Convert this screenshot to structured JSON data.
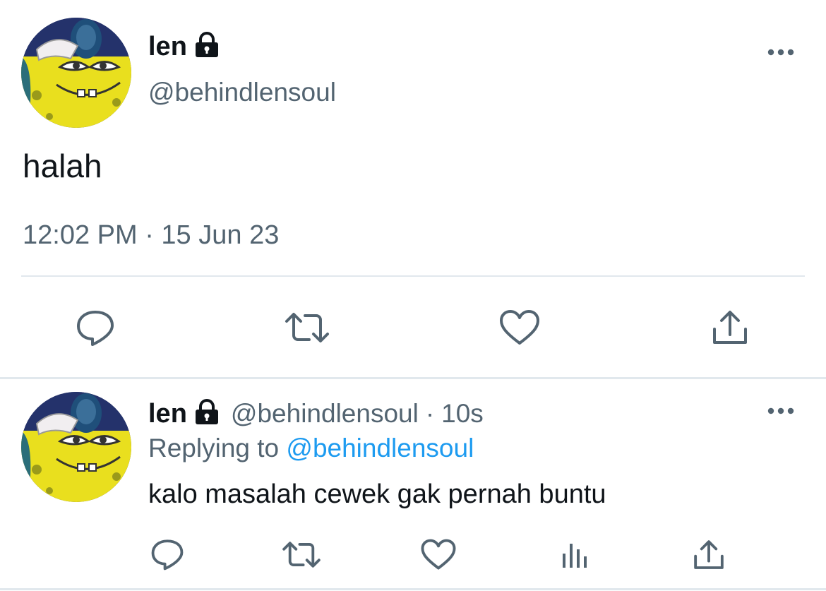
{
  "main_tweet": {
    "display_name": "len",
    "handle": "@behindlensoul",
    "text": "halah",
    "timestamp": "12:02 PM · 15 Jun 23",
    "protected_icon": "lock-icon",
    "more_icon": "more-dots-icon",
    "actions": [
      {
        "name": "reply",
        "icon": "reply-icon"
      },
      {
        "name": "retweet",
        "icon": "retweet-icon"
      },
      {
        "name": "like",
        "icon": "heart-icon"
      },
      {
        "name": "share",
        "icon": "share-icon"
      }
    ]
  },
  "reply_tweet": {
    "display_name": "len",
    "handle": "@behindlensoul",
    "separator": "·",
    "age": "10s",
    "replying_prefix": "Replying to",
    "replying_handle": "@behindlensoul",
    "text": "kalo masalah cewek gak pernah buntu",
    "actions": [
      {
        "name": "reply",
        "icon": "reply-icon"
      },
      {
        "name": "retweet",
        "icon": "retweet-icon"
      },
      {
        "name": "like",
        "icon": "heart-icon"
      },
      {
        "name": "views",
        "icon": "analytics-icon"
      },
      {
        "name": "share",
        "icon": "share-icon"
      }
    ]
  },
  "colors": {
    "text": "#0f1419",
    "muted": "#536471",
    "link": "#1d9bf0",
    "divider": "#e1e8ed"
  }
}
